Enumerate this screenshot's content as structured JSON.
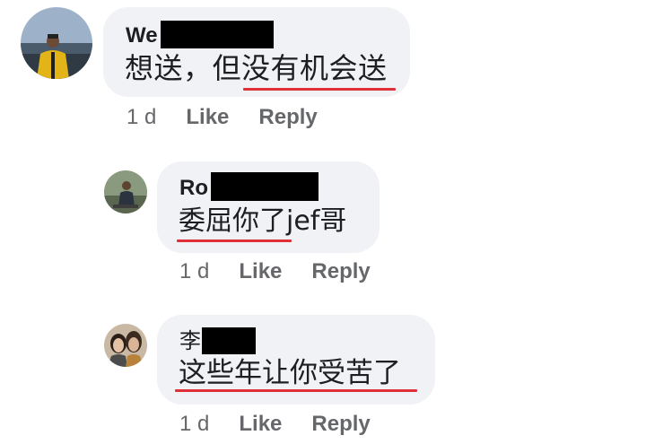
{
  "comments": [
    {
      "author_visible": "We",
      "author_redacted": true,
      "text": "想送，但没有机会送",
      "time": "1 d",
      "like_label": "Like",
      "reply_label": "Reply"
    },
    {
      "author_visible": "Ro",
      "author_redacted": true,
      "text": "委屈你了jef哥",
      "time": "1 d",
      "like_label": "Like",
      "reply_label": "Reply"
    },
    {
      "author_visible": "李",
      "author_redacted": true,
      "text": "这些年让你受苦了",
      "time": "1 d",
      "like_label": "Like",
      "reply_label": "Reply"
    }
  ],
  "colors": {
    "bubble": "#f0f2f5",
    "underline": "#e0303a",
    "meta": "#65676b",
    "text": "#1c1e21"
  }
}
